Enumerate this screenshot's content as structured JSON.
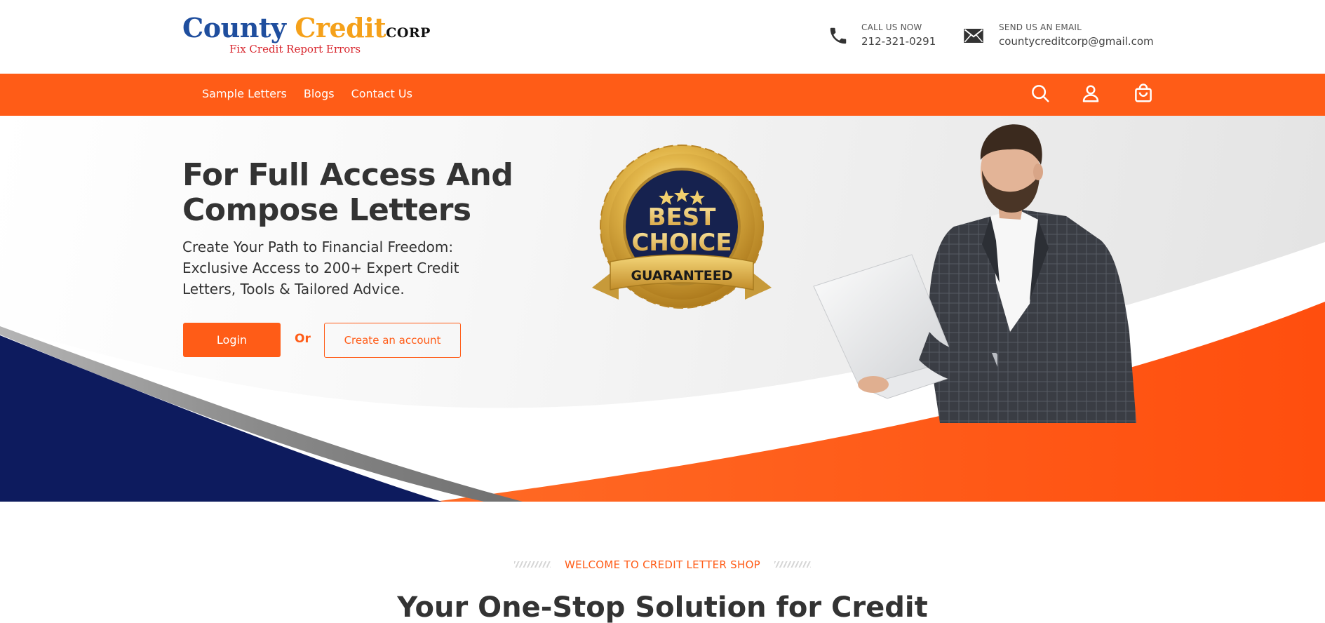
{
  "brand": {
    "word1": "County",
    "word2": "Credit",
    "word3": "CORP",
    "tagline": "Fix Credit Report Errors",
    "colors": {
      "blue": "#1f4e9e",
      "gold": "#f5a11a",
      "red": "#d8262d"
    }
  },
  "header": {
    "call": {
      "label": "CALL US NOW",
      "value": "212-321-0291",
      "icon": "phone-icon"
    },
    "email": {
      "label": "SEND US AN EMAIL",
      "value": "countycreditcorp@gmail.com",
      "icon": "envelope-icon"
    }
  },
  "nav": {
    "links": [
      "Sample Letters",
      "Blogs",
      "Contact Us"
    ],
    "icons": [
      "search-icon",
      "user-icon",
      "shopping-bag-icon"
    ],
    "accent": "#ff5c17"
  },
  "hero": {
    "title": "For Full Access And Compose Letters",
    "subtitle": "Create Your Path to Financial Freedom: Exclusive Access to 200+ Expert Credit Letters, Tools & Tailored Advice.",
    "login_label": "Login",
    "or_label": "Or",
    "create_label": "Create an account",
    "badge": {
      "line1": "BEST",
      "line2": "CHOICE",
      "ribbon": "GUARANTEED"
    },
    "colors": {
      "navy": "#0d1b5e",
      "orange": "#ff5c17"
    }
  },
  "welcome": {
    "eyebrow": "WELCOME TO CREDIT LETTER SHOP",
    "title": "Your One-Stop Solution for Credit"
  }
}
